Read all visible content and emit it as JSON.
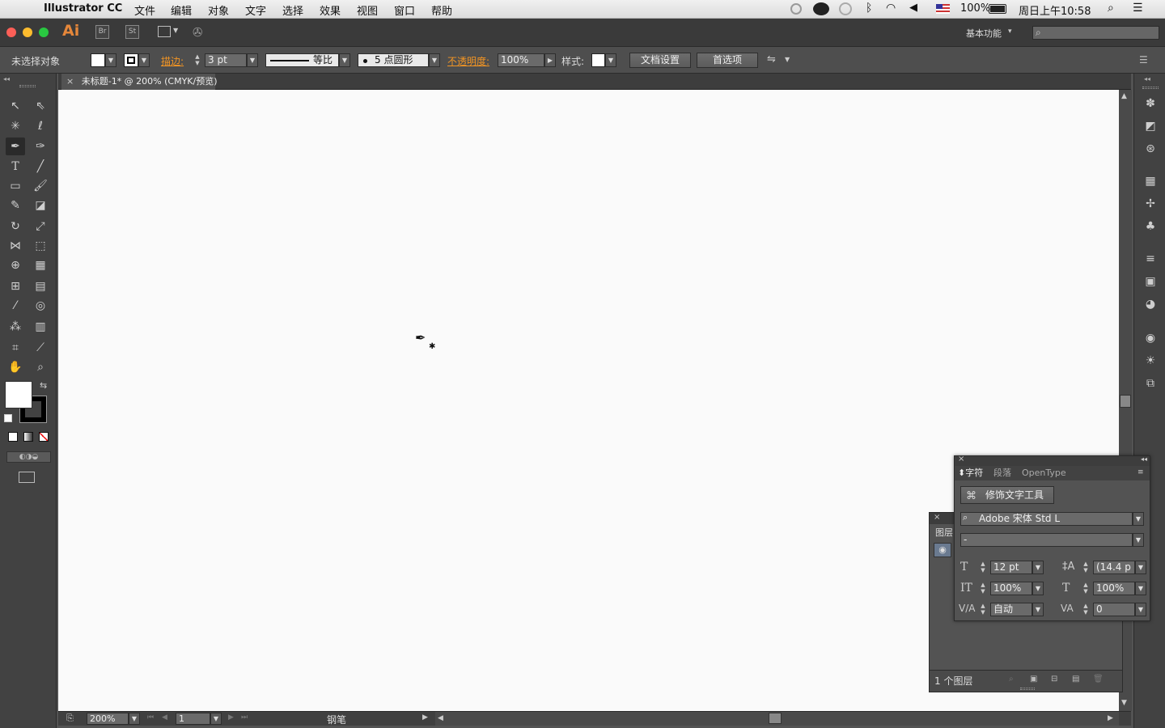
{
  "menubar": {
    "app_name": "Illustrator CC",
    "menus": [
      "文件",
      "编辑",
      "对象",
      "文字",
      "选择",
      "效果",
      "视图",
      "窗口",
      "帮助"
    ],
    "battery": "100%",
    "clock": "周日上午10:58"
  },
  "appbar": {
    "logo": "Ai",
    "bridge": "Br",
    "stock": "St",
    "workspace": "基本功能",
    "workspace_arrow": "▾",
    "search_placeholder": ""
  },
  "control": {
    "selection_status": "未选择对象",
    "stroke_label": "描边:",
    "stroke_weight": "3 pt",
    "stroke_profile": "等比",
    "brush": "5 点圆形",
    "opacity_label": "不透明度:",
    "opacity": "100%",
    "style_label": "样式:",
    "doc_setup": "文档设置",
    "preferences": "首选项"
  },
  "document": {
    "tab_title": "未标题-1* @ 200% (CMYK/预览)",
    "close_glyph": "×"
  },
  "status": {
    "zoom": "200%",
    "artboard": "1",
    "tool_name": "钢笔"
  },
  "layers_panel": {
    "tab": "图层",
    "count": "1 个图层"
  },
  "character_panel": {
    "tabs": [
      "字符",
      "段落",
      "OpenType"
    ],
    "touch_type": "修饰文字工具",
    "font_family": "Adobe 宋体 Std L",
    "font_style": "-",
    "font_size": "12 pt",
    "leading": "(14.4 p",
    "vertical_scale": "100%",
    "horizontal_scale": "100%",
    "kerning": "自动",
    "tracking": "0"
  },
  "colors": {
    "accent": "#f29524",
    "canvas": "#fafafa",
    "chrome": "#535353"
  }
}
